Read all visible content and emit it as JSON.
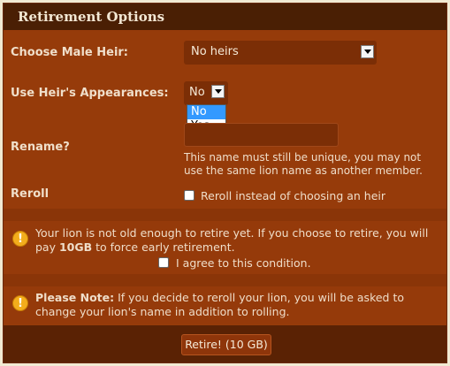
{
  "header": {
    "title": "Retirement Options"
  },
  "heir": {
    "label": "Choose Male Heir:",
    "value": "No heirs"
  },
  "appearance": {
    "label": "Use Heir's Appearances:",
    "value": "No",
    "options": [
      "No",
      "Yes"
    ]
  },
  "rename": {
    "label": "Rename?",
    "hint": "This name must still be unique, you may not use the same lion name as another member."
  },
  "reroll": {
    "label": "Reroll",
    "checkbox_label": "Reroll instead of choosing an heir"
  },
  "age_notice": {
    "text_before": "Your lion is not old enough to retire yet. If you choose to retire, you will pay ",
    "cost": "10GB",
    "text_after": " to force early retirement.",
    "agree_label": "I agree to this condition."
  },
  "note": {
    "title": "Please Note:",
    "text": " If you decide to reroll your lion, you will be asked to change your lion's name in addition to rolling."
  },
  "footer": {
    "submit_label": "Retire! (10 GB)"
  }
}
